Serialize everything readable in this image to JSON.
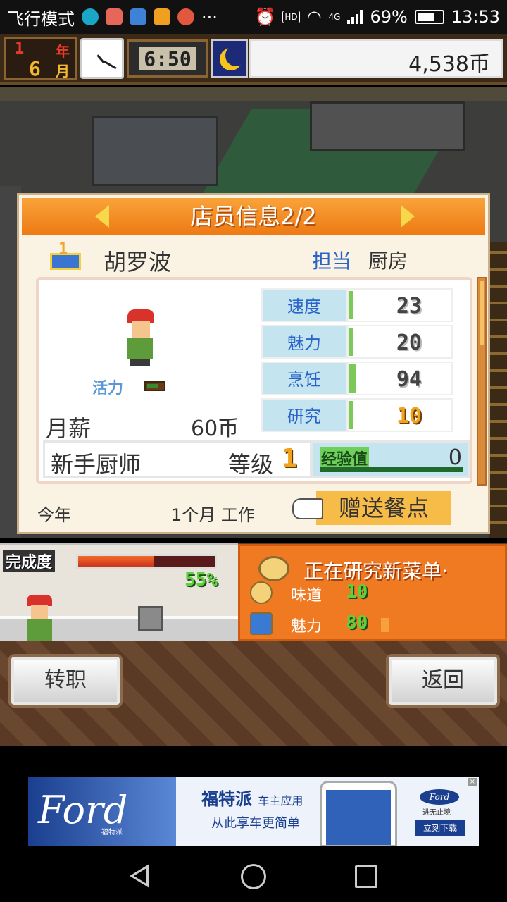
{
  "status_bar": {
    "airplane_mode": "飞行模式",
    "network": "4G",
    "hd": "HD",
    "battery": "69%",
    "time": "13:53"
  },
  "hud": {
    "year_value": "1",
    "year_label": "年",
    "month_value": "6",
    "month_label": "月",
    "game_time": "6:50",
    "coins": "4,538币"
  },
  "staff_dialog": {
    "title": "店员信息2/2",
    "rank_badge": "1",
    "name": "胡罗波",
    "role_label": "担当",
    "role_value": "厨房",
    "vigor_label": "活力",
    "vigor_level": 0.6,
    "salary_label": "月薪",
    "salary_value": "60币",
    "stats": [
      {
        "label": "速度",
        "value": "23",
        "fill": 0.02
      },
      {
        "label": "魅力",
        "value": "20",
        "fill": 0.0
      },
      {
        "label": "烹饪",
        "value": "94",
        "fill": 0.07
      },
      {
        "label": "研究",
        "value": "10",
        "fill": 0.05
      }
    ],
    "job_title": "新手厨师",
    "level_label": "等级",
    "level_value": "1",
    "exp_label": "经验值",
    "exp_value": "0",
    "this_year_label": "今年",
    "tenure": "1个月 工作",
    "gift_button": "赠送餐点"
  },
  "kitchen": {
    "progress_label": "完成度",
    "progress_value": "55%",
    "progress_fraction": 0.55
  },
  "research": {
    "title": "正在研究新菜单·",
    "rows": [
      {
        "label": "味道",
        "value": "10"
      },
      {
        "label": "魅力",
        "value": "80"
      }
    ]
  },
  "buttons": {
    "change_job": "转职",
    "back": "返回"
  },
  "ad": {
    "brand": "Ford",
    "brand_cn": "福特派",
    "headline": "福特派",
    "headline_sub": "车主应用",
    "subline": "从此享车更简单",
    "logo": "Ford",
    "slogan": "进无止境",
    "download": "立刻下载"
  },
  "colors": {
    "dialog_header": "#ee7a14",
    "stat_label_bg": "#c4e4f0",
    "stat_bar": "#7cc95a",
    "gold": "#f2a31c",
    "research_panel": "#f07a22"
  }
}
